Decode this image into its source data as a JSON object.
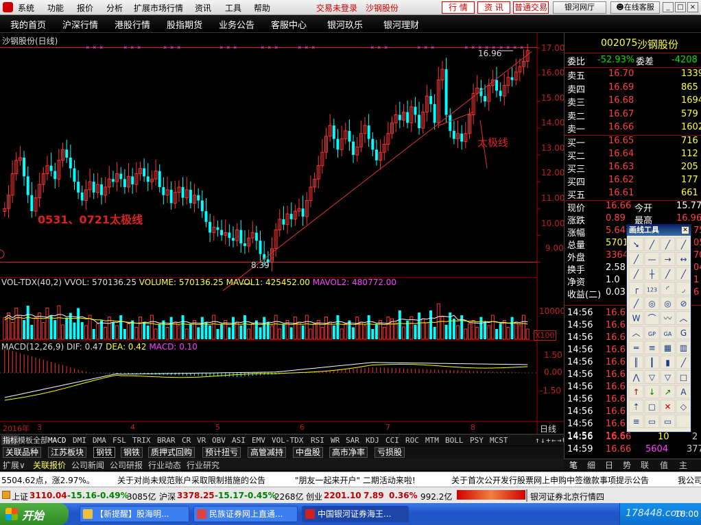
{
  "menu": {
    "items": [
      "系统",
      "功能",
      "报价",
      "分析",
      "扩展市场行情",
      "资讯",
      "工具",
      "帮助"
    ],
    "status_not_logged": "交易未登录",
    "stock_title": "沙钢股份",
    "btn_quote": "行 情",
    "btn_info": "资 讯",
    "btn_trade": "普通交易",
    "btn_net": "银河网厅",
    "btn_service": "在线客服"
  },
  "nav": {
    "items": [
      "我的首页",
      "沪深行情",
      "港股行情",
      "股指期货",
      "业务公告",
      "客服中心",
      "银河玖乐",
      "银河理财"
    ]
  },
  "chart": {
    "title": "沙钢股份(日线)",
    "high_label": "16.96",
    "low_label": "8.39",
    "annotation_left": "0531、0721太极线",
    "annotation_right": "太极线",
    "y_ticks": [
      "17.00",
      "16.00",
      "15.00",
      "14.00",
      "13.00",
      "12.00",
      "11.00",
      "10.00",
      "9.00"
    ],
    "vol_header": {
      "name": "VOL-TDX(40,2)",
      "vvol": "VVOL: 570136.25",
      "volume": "VOLUME: 570136.25",
      "mavol1": "MAVOL1: 425452.00",
      "mavol2": "MAVOL2: 480772.00"
    },
    "vol_scale": "10000",
    "vol_unit": "X100",
    "macd_header": {
      "name": "MACD(12,26,9)",
      "dif": "DIF: 0.47",
      "dea": "DEA: 0.42",
      "macd": "MACD: 0.10"
    },
    "macd_ticks": [
      "1.50",
      "0.50",
      "0.00",
      "-1.50"
    ],
    "x_labels": [
      "2016年",
      "3",
      "4",
      "5",
      "6",
      "7",
      "8"
    ],
    "period": "日线",
    "colors": {
      "up": "#ff3333",
      "down": "#00ffff",
      "line_red": "#e03030",
      "axis_red": "#b00000",
      "ma_white": "#ffffff",
      "ma_yellow": "#ffff00",
      "ma_magenta": "#ff40ff"
    }
  },
  "chart_data": {
    "type": "candlestick",
    "y_range": [
      8.6,
      17.2
    ],
    "closes": [
      11.0,
      11.5,
      12.3,
      12.8,
      12.9,
      12.2,
      11.5,
      10.9,
      11.4,
      11.9,
      12.3,
      12.6,
      12.4,
      12.1,
      12.8,
      13.2,
      12.9,
      12.5,
      12.0,
      11.6,
      11.3,
      11.7,
      12.0,
      11.6,
      11.9,
      11.5,
      11.8,
      12.1,
      12.0,
      12.3,
      12.1,
      11.8,
      12.2,
      11.9,
      12.3,
      12.5,
      12.2,
      12.0,
      12.1,
      12.4,
      11.8,
      11.5,
      11.7,
      11.2,
      11.6,
      11.8,
      11.4,
      11.7,
      11.2,
      11.5,
      11.3,
      10.9,
      10.5,
      10.1,
      10.3,
      10.2,
      10.0,
      10.1,
      9.9,
      9.8,
      10.2,
      9.7,
      9.6,
      9.9,
      10.1,
      9.8,
      9.3,
      9.1,
      9.0,
      9.5,
      10.2,
      10.6,
      10.4,
      10.8,
      10.6,
      10.9,
      11.0,
      10.7,
      11.3,
      11.8,
      12.1,
      12.6,
      13.1,
      13.7,
      14.1,
      13.6,
      13.2,
      13.6,
      13.9,
      13.5,
      13.0,
      13.3,
      13.8,
      14.1,
      13.6,
      13.2,
      12.8,
      13.1,
      13.4,
      13.8,
      14.2,
      14.5,
      14.3,
      14.6,
      14.2,
      14.8,
      14.5,
      14.0,
      14.6,
      15.2,
      14.9,
      14.2,
      15.8,
      16.2,
      14.5,
      13.9,
      13.6,
      13.8,
      13.5,
      13.8,
      14.5,
      15.3,
      15.5,
      15.2,
      15.0,
      15.6,
      15.8,
      15.4,
      15.2,
      15.6,
      15.9,
      15.8,
      16.1,
      16.3,
      16.5,
      16.9
    ],
    "high_marker": 16.96,
    "low_marker": 8.39,
    "taiji_line": {
      "from": [
        8.39
      ],
      "to": [
        16.5
      ]
    },
    "horizontal_line": 9.0,
    "indicators": {
      "vol": {
        "vvol": 570136.25,
        "mavol1": 425452.0,
        "mavol2": 480772.0
      },
      "macd": {
        "dif": 0.47,
        "dea": 0.42,
        "macd": 0.1
      }
    }
  },
  "bottom_tabs": {
    "items": [
      "指标",
      "模板",
      "全部",
      "MACD",
      "DMI",
      "DMA",
      "FSL",
      "TRIX",
      "BRAR",
      "CR",
      "VR",
      "OBV",
      "ASI",
      "EMV",
      "VOL-TDX",
      "RSI",
      "WR",
      "SAR",
      "KDJ",
      "CCI",
      "ROC",
      "MTM",
      "BOLL",
      "PSY",
      "MCST"
    ],
    "nav_symbols": [
      "↑",
      "↓",
      "+",
      "←",
      "→",
      "0"
    ]
  },
  "sector_tabs": {
    "items": [
      "关联品种",
      "江苏板块",
      "钢铁",
      "钢铁",
      "质押式回购",
      "预计扭亏",
      "高管减持",
      "中盘股",
      "高市净率",
      "亏损股"
    ]
  },
  "info_tabs": {
    "items": [
      "扩展∨",
      "关联报价",
      "公司新闻",
      "公司研报",
      "行业动态",
      "行业研究"
    ]
  },
  "quote": {
    "code": "002075",
    "name": "沙钢股份",
    "wb_label": "委比",
    "wb_val": "-52.93%",
    "wc_label": "委差",
    "wc_val": "-4208",
    "asks": [
      {
        "label": "卖五",
        "price": "16.70",
        "vol": "1339"
      },
      {
        "label": "卖四",
        "price": "16.69",
        "vol": "865"
      },
      {
        "label": "卖三",
        "price": "16.68",
        "vol": "1694"
      },
      {
        "label": "卖二",
        "price": "16.67",
        "vol": "579"
      },
      {
        "label": "卖一",
        "price": "16.66",
        "vol": "1602"
      }
    ],
    "bids": [
      {
        "label": "买一",
        "price": "16.65",
        "vol": "716"
      },
      {
        "label": "买二",
        "price": "16.64",
        "vol": "112"
      },
      {
        "label": "买三",
        "price": "16.63",
        "vol": "205"
      },
      {
        "label": "买四",
        "price": "16.62",
        "vol": "177"
      },
      {
        "label": "买五",
        "price": "16.61",
        "vol": "661"
      }
    ],
    "stats": [
      {
        "label": "现价",
        "val": "16.66",
        "label2": "今开",
        "val2": "15.77"
      },
      {
        "label": "涨跌",
        "val": "0.89",
        "label2": "最高",
        "val2": "16.96"
      },
      {
        "label": "涨幅",
        "val": "5.64",
        "label2": "",
        "val2": "75"
      },
      {
        "label": "总量",
        "val": "57013",
        "label2": "",
        "val2": "05"
      },
      {
        "label": "外盘",
        "val": "33646",
        "label2": "",
        "val2": "70"
      },
      {
        "label": "换手",
        "val": "2.58",
        "label2": "",
        "val2": "04"
      },
      {
        "label": "净资",
        "val": "1.0",
        "label2": "",
        "val2": "1"
      },
      {
        "label": "收益(二)",
        "val": "0.03",
        "label2": "",
        "val2": "6"
      }
    ],
    "ticks": [
      {
        "time": "14:56",
        "price": "16.6"
      },
      {
        "time": "14:56",
        "price": "16.6"
      },
      {
        "time": "14:56",
        "price": "16.6"
      },
      {
        "time": "14:56",
        "price": "16.6"
      },
      {
        "time": "14:56",
        "price": "16.6"
      },
      {
        "time": "14:56",
        "price": "16.6"
      },
      {
        "time": "14:56",
        "price": "16.6"
      },
      {
        "time": "14:56",
        "price": "16.6"
      },
      {
        "time": "14:56",
        "price": "16.6"
      },
      {
        "time": "14:56",
        "price": "16.6"
      },
      {
        "time": "14:56",
        "price": "16.6"
      }
    ],
    "last_ticks": [
      {
        "time": "14:56",
        "price": "16.66",
        "vol": "10",
        "n": "2"
      },
      {
        "time": "14:59",
        "price": "16.66",
        "vol": "5604",
        "n": "377"
      }
    ]
  },
  "right_tabs": {
    "items": [
      "笔",
      "细",
      "日",
      "势",
      "联",
      "值",
      "主"
    ]
  },
  "draw_tool": {
    "title": "画线工具",
    "close": "✕"
  },
  "ticker": {
    "items": [
      "5504.62点，涨2.97%。",
      "关于对尚未规范账户采取限制措施的公告",
      "\"朋友一起来开户\" 二期活动来啦!",
      "关于首次公开发行股票网上申购中签缴款事项提示公告",
      "我公司"
    ]
  },
  "indices": {
    "sh": {
      "label": "上证",
      "val": "3110.04",
      "chg": "-15.16",
      "pct": "-0.49%",
      "amt": "3085亿"
    },
    "hs": {
      "label": "沪深",
      "val": "3378.25",
      "chg": "-15.17",
      "pct": "-0.45%",
      "amt": "2268亿"
    },
    "cy": {
      "label": "创业",
      "val": "2201.10",
      "chg": "7.89",
      "pct": "0.36%",
      "amt": "992.2亿"
    },
    "broker": "银河证券北京行情四"
  },
  "taskbar": {
    "start": "开始",
    "items": [
      "【新提醒】股海明...",
      "民族证券网上直通...",
      "中国银河证券海王..."
    ],
    "clock": "16:00",
    "watermark": "178448.com"
  }
}
